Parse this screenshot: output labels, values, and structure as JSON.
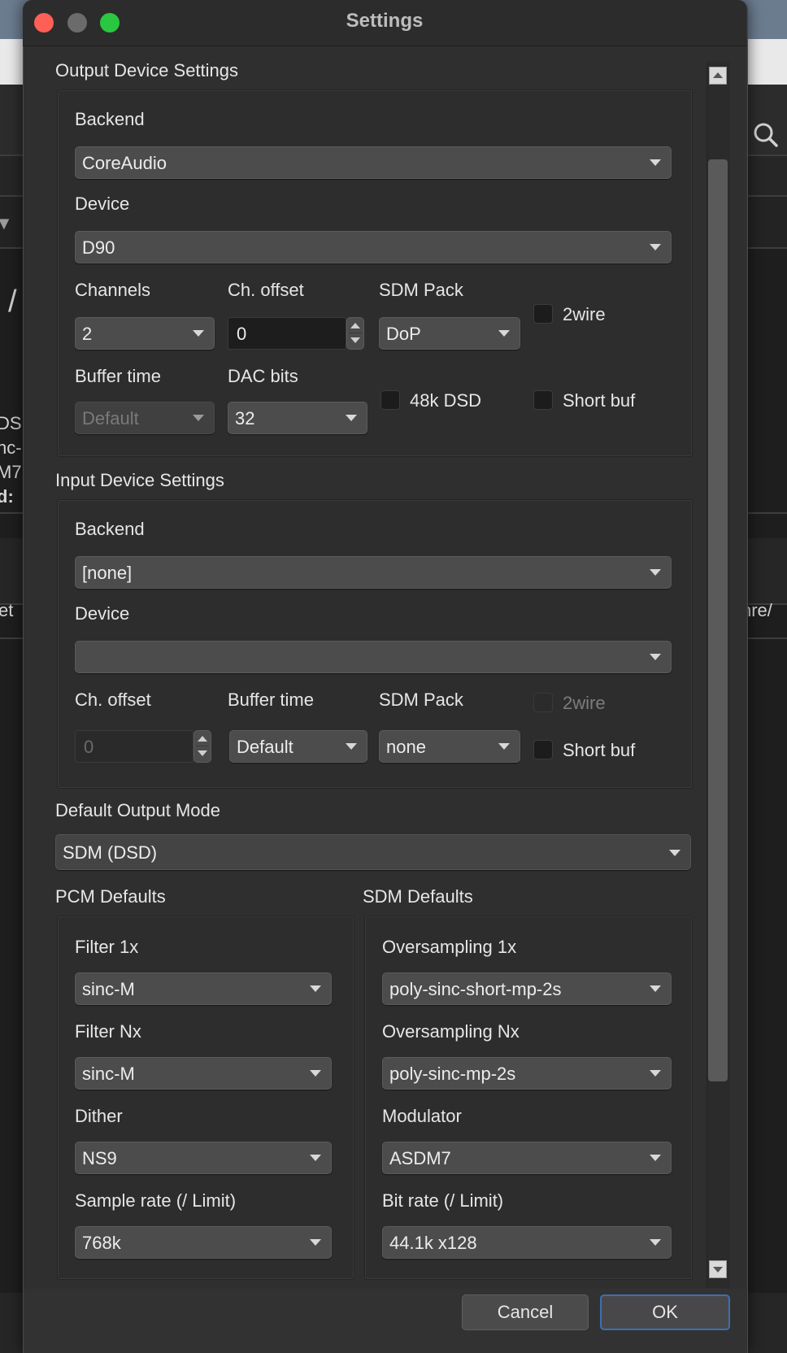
{
  "window": {
    "title": "Settings"
  },
  "background_fragments": {
    "search_icon": "search-icon",
    "left_arrow": "▼",
    "left_slash": "/",
    "left_ds": "DS",
    "left_nc": "nc-",
    "left_m7": "M7",
    "left_d": "d:",
    "left_et": "et",
    "right_hre": "hre/"
  },
  "output": {
    "group_title": "Output Device Settings",
    "backend_label": "Backend",
    "backend_value": "CoreAudio",
    "device_label": "Device",
    "device_value": "D90",
    "channels_label": "Channels",
    "channels_value": "2",
    "ch_offset_label": "Ch. offset",
    "ch_offset_value": "0",
    "sdm_pack_label": "SDM Pack",
    "sdm_pack_value": "DoP",
    "twowire_label": "2wire",
    "buffer_time_label": "Buffer time",
    "buffer_time_value": "Default",
    "dac_bits_label": "DAC bits",
    "dac_bits_value": "32",
    "dsd48k_label": "48k DSD",
    "short_buf_label": "Short buf"
  },
  "input": {
    "group_title": "Input Device Settings",
    "backend_label": "Backend",
    "backend_value": "[none]",
    "device_label": "Device",
    "device_value": "",
    "ch_offset_label": "Ch. offset",
    "ch_offset_value": "0",
    "buffer_time_label": "Buffer time",
    "buffer_time_value": "Default",
    "sdm_pack_label": "SDM Pack",
    "sdm_pack_value": "none",
    "twowire_label": "2wire",
    "short_buf_label": "Short buf"
  },
  "default_output_mode": {
    "label": "Default Output Mode",
    "value": "SDM (DSD)"
  },
  "pcm": {
    "group_title": "PCM Defaults",
    "filter1x_label": "Filter 1x",
    "filter1x_value": "sinc-M",
    "filterNx_label": "Filter Nx",
    "filterNx_value": "sinc-M",
    "dither_label": "Dither",
    "dither_value": "NS9",
    "samplerate_label": "Sample rate (/ Limit)",
    "samplerate_value": "768k"
  },
  "sdm": {
    "group_title": "SDM Defaults",
    "os1x_label": "Oversampling 1x",
    "os1x_value": "poly-sinc-short-mp-2s",
    "osNx_label": "Oversampling Nx",
    "osNx_value": "poly-sinc-mp-2s",
    "modulator_label": "Modulator",
    "modulator_value": "ASDM7",
    "bitrate_label": "Bit rate (/ Limit)",
    "bitrate_value": "44.1k x128"
  },
  "buttons": {
    "cancel": "Cancel",
    "ok": "OK"
  }
}
